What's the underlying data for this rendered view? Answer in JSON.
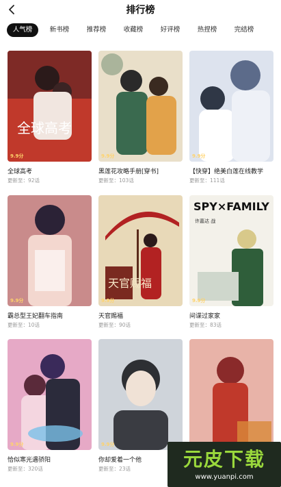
{
  "header": {
    "title": "排行榜"
  },
  "tabs": [
    {
      "label": "人气榜"
    },
    {
      "label": "新书榜"
    },
    {
      "label": "推荐榜"
    },
    {
      "label": "收藏榜"
    },
    {
      "label": "好评榜"
    },
    {
      "label": "热捏榜"
    },
    {
      "label": "完结榜"
    }
  ],
  "books": [
    {
      "title": "全球高考",
      "update": "更新至：92话",
      "score": "9.9分",
      "cover_color": "#c0392b",
      "accent": "#2b1a1a"
    },
    {
      "title": "黑莲花攻略手册[穿书]",
      "update": "更新至：103话",
      "score": "9.9分",
      "cover_color": "#d9c8a9",
      "accent": "#3a6a4f"
    },
    {
      "title": "【快穿】绝美白莲在线教学",
      "update": "更新至：111话",
      "score": "9.9分",
      "cover_color": "#dde3ee",
      "accent": "#5c6b8a"
    },
    {
      "title": "霸总型王妃翻车指南",
      "update": "更新至：10话",
      "score": "9.9分",
      "cover_color": "#c98b8b",
      "accent": "#2b2236"
    },
    {
      "title": "天官赐福",
      "update": "更新至：90话",
      "score": "9.9分",
      "cover_color": "#e8d9b8",
      "accent": "#b22222"
    },
    {
      "title": "间谍过家家",
      "update": "更新至：83话",
      "score": "9.9分",
      "cover_color": "#f3f1ea",
      "accent": "#2f5e3a"
    },
    {
      "title": "恰似寒光遇骄阳",
      "update": "更新至：320话",
      "score": "9.9分",
      "cover_color": "#e6a9c6",
      "accent": "#3a2a5a"
    },
    {
      "title": "你却爱着一个他",
      "update": "更新至：23话",
      "score": "9.9分",
      "cover_color": "#cfd4da",
      "accent": "#2d2f33"
    },
    {
      "title": "",
      "update": "",
      "score": "",
      "cover_color": "#e8b3a8",
      "accent": "#8a2a2a"
    }
  ],
  "cover_texts": {
    "book1": "全球高考",
    "book5": "天官赐福",
    "book6": "SPY×FAMILY",
    "book6_sub": "许嘉达 战"
  },
  "watermark": {
    "main": "元皮下载",
    "url": "www.yuanpi.com"
  }
}
